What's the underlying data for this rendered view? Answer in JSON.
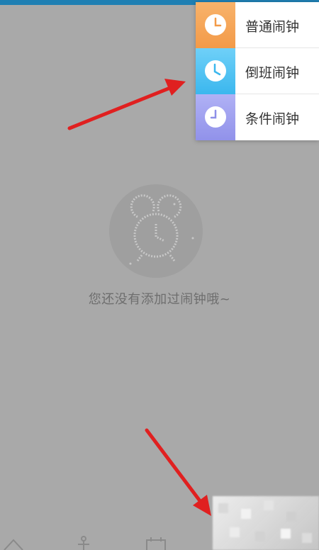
{
  "menu": {
    "items": [
      {
        "label": "普通闹钟",
        "icon": "clock-icon",
        "color": "#f7a35c"
      },
      {
        "label": "倒班闹钟",
        "icon": "clock-icon",
        "color": "#4fc3f7"
      },
      {
        "label": "条件闹钟",
        "icon": "clock-icon",
        "color": "#9fa0f0"
      }
    ]
  },
  "empty": {
    "message": "您还没有添加过闹钟哦~",
    "icon": "alarm-clock-icon"
  },
  "tabbar": {
    "icons": [
      "home-icon",
      "anchor-icon",
      "calendar-icon"
    ]
  },
  "colors": {
    "topbar": "#1f7fb3",
    "overlay": "#a9a9a9",
    "arrow": "#e02020"
  }
}
